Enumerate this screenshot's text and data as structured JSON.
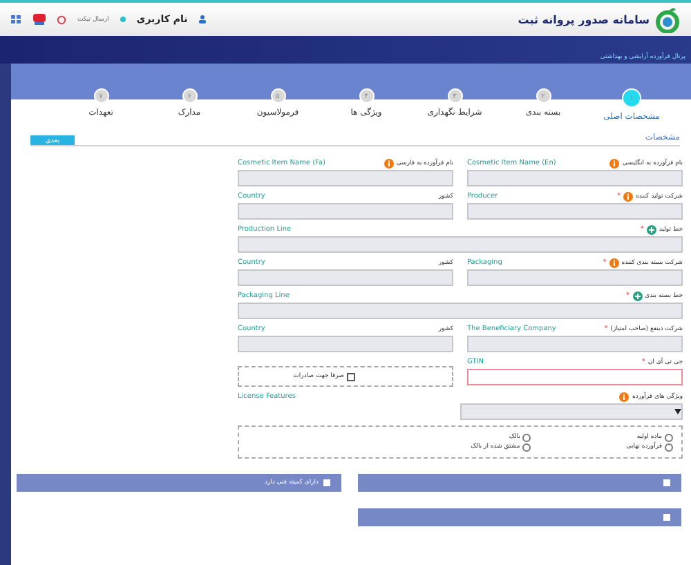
{
  "header": {
    "title": "سامانه صدور پروانه ثبت",
    "user": "نام کاربری",
    "ticket": "ارسال تیکت"
  },
  "portal": "پرتال فرآورده آرایشی و بهداشتی",
  "steps": [
    {
      "number": "۱",
      "label": "مشخصات اصلی",
      "selected": true
    },
    {
      "number": "۲",
      "label": "بسته بندی",
      "selected": false
    },
    {
      "number": "۳",
      "label": "شرایط نگهداری",
      "selected": false
    },
    {
      "number": "۴",
      "label": "ویژگی ها",
      "selected": false
    },
    {
      "number": "۵",
      "label": "فرمولاسیون",
      "selected": false
    },
    {
      "number": "۶",
      "label": "مدارک",
      "selected": false
    },
    {
      "number": "۷",
      "label": "تعهدات",
      "selected": false
    }
  ],
  "section": {
    "title": "مشخصات",
    "button": "بعدی"
  },
  "rows": [
    {
      "cells": [
        {
          "kind": "input",
          "label": "نام فرآورده به انگلیسی",
          "hint": "Cosmetic Item Name (En)",
          "info": true
        },
        {
          "kind": "input",
          "label": "نام فرآورده به فارسی",
          "hint": "Cosmetic Item Name (Fa)",
          "info": true
        }
      ]
    },
    {
      "cells": [
        {
          "kind": "input",
          "label": "شرکت تولید کننده",
          "hint": "Producer",
          "required_mark": "*",
          "info": true
        },
        {
          "kind": "input",
          "label": "کشور",
          "hint": "Country"
        }
      ]
    },
    {
      "cells": [
        {
          "kind": "wide",
          "label": "خط تولید",
          "hint": "Production Line",
          "required_mark": "*",
          "add": true
        }
      ]
    },
    {
      "cells": [
        {
          "kind": "input",
          "label": "شرکت بسته بندی کننده",
          "hint": "Packaging",
          "required_mark": "*",
          "info": true
        },
        {
          "kind": "input",
          "label": "کشور",
          "hint": "Country"
        }
      ]
    },
    {
      "cells": [
        {
          "kind": "wide",
          "label": "خط بسته بندی",
          "hint": "Packaging Line",
          "required_mark": "*",
          "add": true
        }
      ]
    },
    {
      "cells": [
        {
          "kind": "input",
          "label": "شرکت ذینفع (صاحب امتیاز)",
          "hint": "The Beneficiary Company",
          "required_mark": "*"
        },
        {
          "kind": "input",
          "label": "کشور",
          "hint": "Country"
        }
      ]
    },
    {
      "cells": [
        {
          "kind": "input",
          "label": "جی تی آی ان",
          "hint": "GTIN",
          "required_mark": "*",
          "error": true
        },
        {
          "kind": "checkbox",
          "label": "صرفا جهت صادرات",
          "checked": false
        }
      ]
    },
    {
      "cells": [
        {
          "kind": "select",
          "label": "ویژگی های فرآورده",
          "hint": "License Features",
          "info": true
        }
      ]
    }
  ],
  "radios": [
    {
      "label": "ماده اولیه",
      "selected": false
    },
    {
      "label": "فرآورده نهایی",
      "selected": false
    },
    {
      "label": "بالک",
      "selected": false
    },
    {
      "label": "مشتق شده از بالک",
      "selected": false
    }
  ],
  "bars": [
    {
      "checked": false
    },
    {
      "label": "دارای کمیته فنی دارد",
      "checked": false
    },
    {
      "checked": false
    }
  ]
}
